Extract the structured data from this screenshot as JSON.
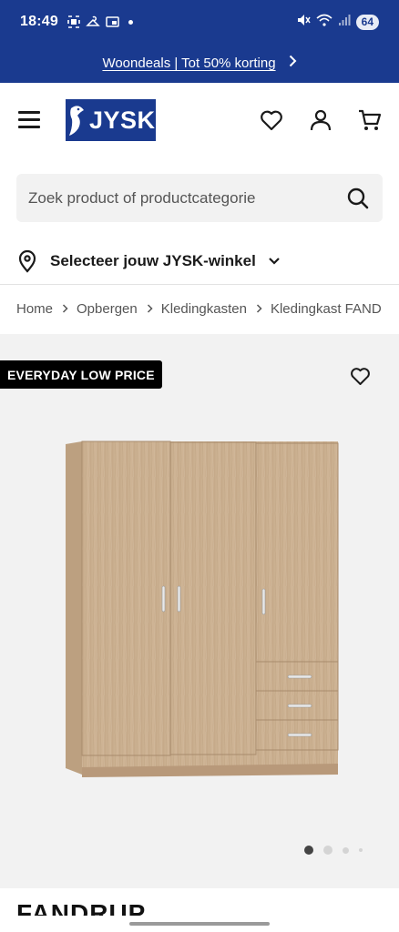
{
  "status_bar": {
    "time": "18:49",
    "battery": "64",
    "icons": [
      "screenshot-icon",
      "hanger-icon",
      "media-icon",
      "mute-icon",
      "wifi-icon",
      "signal-icon",
      "battery-icon"
    ]
  },
  "promo": {
    "text": "Woondeals | Tot 50% korting",
    "icon": "chevron-right-icon"
  },
  "header": {
    "logo_text": "JYSK",
    "brand_color": "#1a3a8f",
    "icons": [
      "menu-icon",
      "heart-icon",
      "user-icon",
      "cart-icon"
    ]
  },
  "search": {
    "placeholder": "Zoek product of productcategorie",
    "value": ""
  },
  "store": {
    "label": "Selecteer jouw JYSK-winkel"
  },
  "breadcrumb": {
    "items": [
      "Home",
      "Opbergen",
      "Kledingkasten",
      "Kledingkast FAND"
    ]
  },
  "gallery": {
    "badge": "EVERYDAY LOW PRICE",
    "active_image": 1,
    "image_count": 4
  },
  "product": {
    "title": "FANDRUP"
  }
}
